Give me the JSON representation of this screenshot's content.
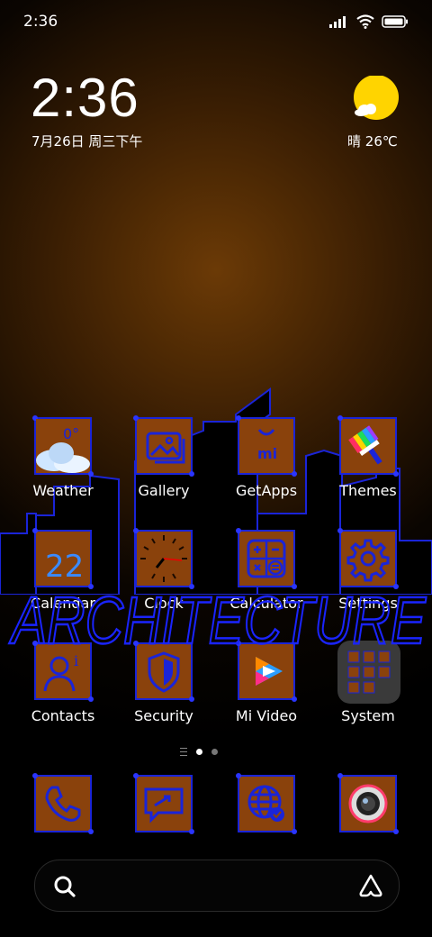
{
  "status_bar": {
    "time": "2:36",
    "icons": [
      "signal-icon",
      "wifi-icon",
      "battery-icon"
    ]
  },
  "clock_widget": {
    "time": "2:36",
    "date": "7月26日 周三下午"
  },
  "weather_widget": {
    "condition": "晴",
    "temperature": "26℃",
    "icon": "sun-cloud-icon"
  },
  "wallpaper_text": "ARCHITECTURE",
  "apps": [
    {
      "label": "Weather",
      "icon": "weather-icon",
      "badge": "0°"
    },
    {
      "label": "Gallery",
      "icon": "gallery-icon"
    },
    {
      "label": "GetApps",
      "icon": "getapps-icon"
    },
    {
      "label": "Themes",
      "icon": "themes-icon"
    },
    {
      "label": "Calendar",
      "icon": "calendar-icon",
      "badge": "22"
    },
    {
      "label": "Clock",
      "icon": "clock-icon"
    },
    {
      "label": "Calculator",
      "icon": "calculator-icon"
    },
    {
      "label": "Settings",
      "icon": "settings-icon"
    },
    {
      "label": "Contacts",
      "icon": "contacts-icon"
    },
    {
      "label": "Security",
      "icon": "security-icon"
    },
    {
      "label": "Mi Video",
      "icon": "mi-video-icon"
    },
    {
      "label": "System",
      "icon": "system-folder-icon"
    }
  ],
  "dock": [
    {
      "icon": "phone-icon"
    },
    {
      "icon": "messages-icon"
    },
    {
      "icon": "browser-icon"
    },
    {
      "icon": "camera-icon"
    }
  ],
  "page_indicator": {
    "pages": 2,
    "active": 1
  },
  "search": {
    "icon": "search-icon",
    "assistant_icon": "assistant-icon"
  },
  "colors": {
    "tile_fill": "#8a420c",
    "tile_border": "#1a24d8",
    "icon_blue": "#1a24d8",
    "sun": "#ffd400"
  }
}
